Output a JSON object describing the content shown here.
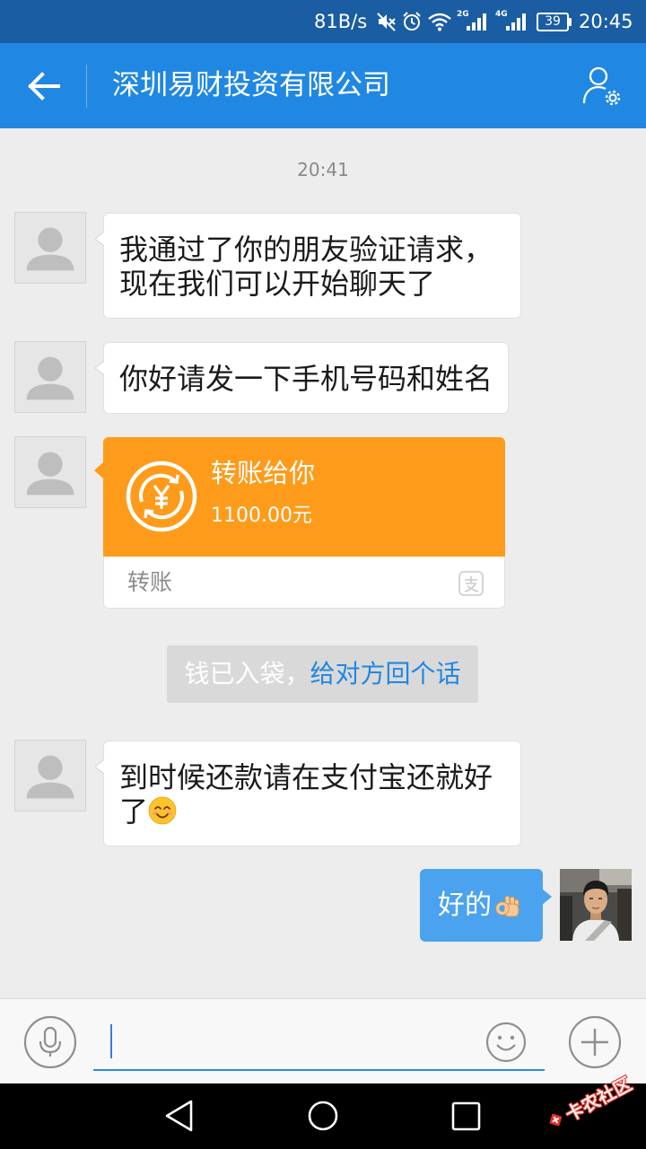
{
  "status_bar": {
    "net_speed": "81B/s",
    "signal_1_label": "2G",
    "signal_2_label": "4G",
    "battery_level": "39",
    "time": "20:45",
    "icons": [
      "mute-icon",
      "alarm-icon",
      "wifi-icon",
      "signal-icon",
      "signal-icon",
      "battery-icon"
    ]
  },
  "header": {
    "title": "深圳易财投资有限公司",
    "left_icon": "back-arrow-icon",
    "right_icon": "contact-settings-icon"
  },
  "chat": {
    "timestamp": "20:41",
    "msg1": {
      "lines": [
        "我通过了你的朋友验证请求，",
        "现在我们可以开始聊天了"
      ]
    },
    "msg2": {
      "text": "你好请发一下手机号码和姓名"
    },
    "transfer": {
      "title": "转账给你",
      "amount": "1100.00元",
      "footer": "转账",
      "icon": "yuan-transfer-icon",
      "footer_icon": "alipay-icon"
    },
    "notice": {
      "text": "钱已入袋，",
      "link": "给对方回个话"
    },
    "msg4": {
      "lines": [
        "到时候还款请在支付宝还就好",
        "了"
      ],
      "emoji": "smiling-face-emoji"
    },
    "msg5": {
      "text": "好的",
      "emoji": "ok-hand-emoji"
    },
    "other_avatar_icon": "default-user-icon",
    "my_avatar": "user-photo"
  },
  "input_bar": {
    "value": "",
    "left_icon": "microphone-icon",
    "emoji_icon": "smiley-icon",
    "add_icon": "plus-icon"
  },
  "nav_bar": {
    "icons": [
      "back-icon",
      "home-icon",
      "recent-apps-icon"
    ]
  },
  "watermark": {
    "text": "卡农社区"
  },
  "colors": {
    "status_bar": "#1b5da3",
    "header": "#2088e2",
    "chat_background": "#ededed",
    "transfer_card": "#ff9b1a",
    "my_bubble": "#4ba3ef",
    "link": "#1f87e0",
    "nav_bar": "#000000"
  }
}
